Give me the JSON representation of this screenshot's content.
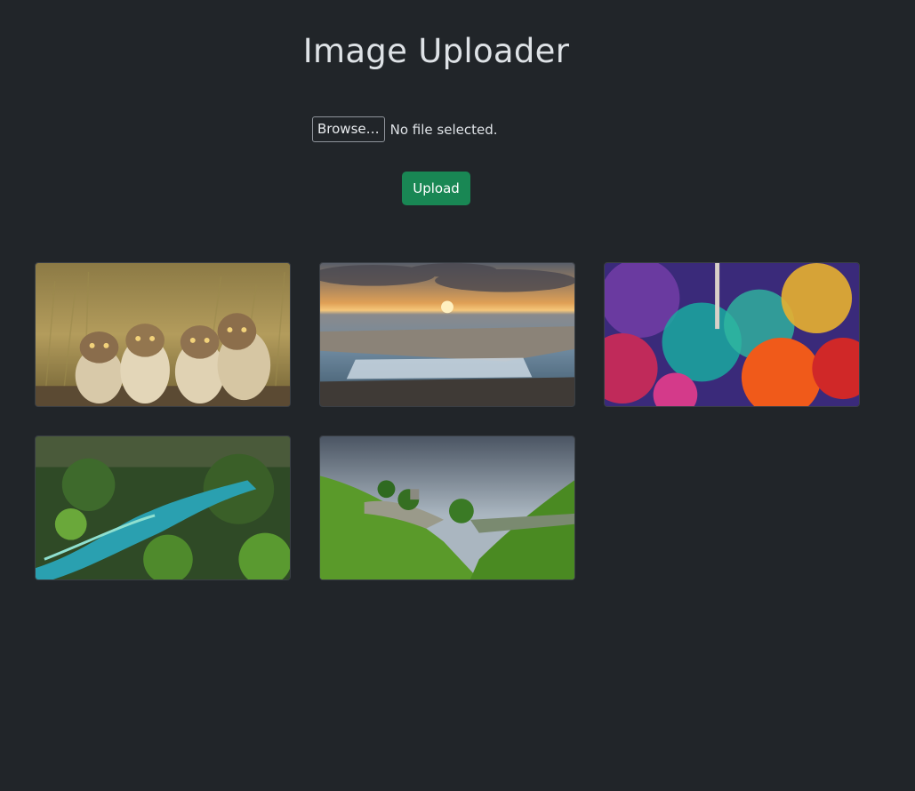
{
  "header": {
    "title": "Image Uploader"
  },
  "upload_form": {
    "browse_label": "Browse…",
    "file_status": "No file selected.",
    "upload_label": "Upload",
    "upload_color": "#198754"
  },
  "gallery": {
    "images": [
      {
        "subject": "burrowing owls in grass"
      },
      {
        "subject": "sea waterfall at sunset"
      },
      {
        "subject": "holi color festival crowd"
      },
      {
        "subject": "forest river with ferns"
      },
      {
        "subject": "green valley with rocky hills"
      }
    ]
  },
  "colors": {
    "background": "#212529",
    "text": "#dee2e6"
  }
}
